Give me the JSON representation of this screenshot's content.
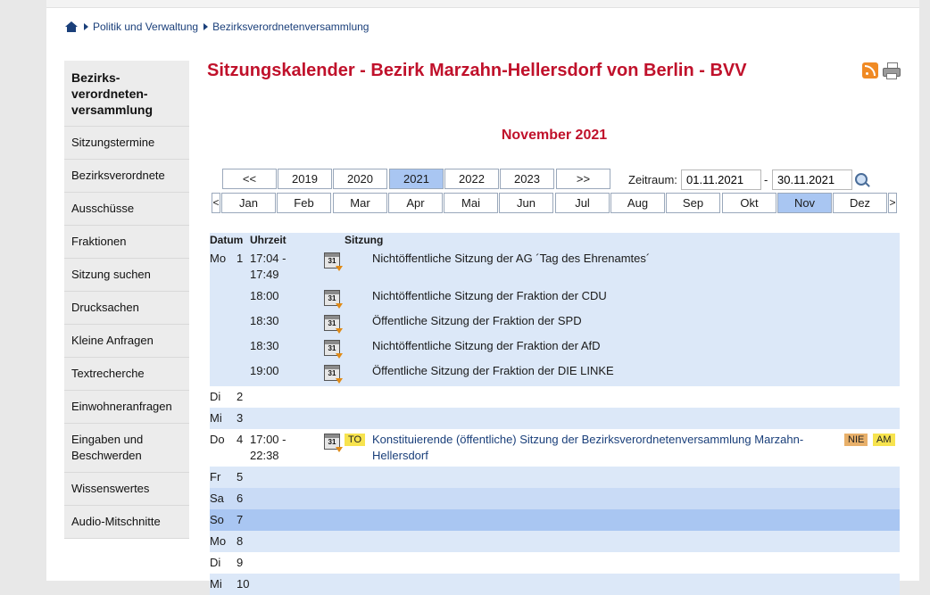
{
  "breadcrumb": {
    "items": [
      "Politik und Verwaltung",
      "Bezirksverordnetenversammlung"
    ]
  },
  "sidebar": {
    "heading": "Bezirks- verordneten- versammlung",
    "heading_lines": [
      "Bezirks-",
      "verordneten-",
      "versammlung"
    ],
    "items": [
      "Sitzungstermine",
      "Bezirksverordnete",
      "Ausschüsse",
      "Fraktionen",
      "Sitzung suchen",
      "Drucksachen",
      "Kleine Anfragen",
      "Textrecherche",
      "Einwohneranfragen",
      "Eingaben und Beschwerden",
      "Wissenswertes",
      "Audio-Mitschnitte"
    ]
  },
  "page": {
    "title": "Sitzungskalender - Bezirk Marzahn-Hellersdorf von Berlin - BVV",
    "month_heading": "November 2021"
  },
  "icons": [
    "rss-icon",
    "printer-icon",
    "search-icon",
    "calendar-icon",
    "home-icon"
  ],
  "year_nav": {
    "prev": "<<",
    "years": [
      "2019",
      "2020",
      "2021",
      "2022",
      "2023"
    ],
    "next": ">>",
    "selected": "2021"
  },
  "month_nav": {
    "prev": "<",
    "months": [
      "Jan",
      "Feb",
      "Mar",
      "Apr",
      "Mai",
      "Jun",
      "Jul",
      "Aug",
      "Sep",
      "Okt",
      "Nov",
      "Dez"
    ],
    "next": ">",
    "selected": "Nov"
  },
  "zeitraum": {
    "label": "Zeitraum:",
    "from": "01.11.2021",
    "to": "30.11.2021",
    "separator": "-"
  },
  "table": {
    "headers": {
      "datum": "Datum",
      "uhrzeit": "Uhrzeit",
      "sitzung": "Sitzung"
    },
    "day1": {
      "wd": "Mo",
      "num": "1"
    },
    "day1_sessions": [
      {
        "time1": "17:04 -",
        "time2": "17:49",
        "title": "Nichtöffentliche Sitzung der AG ´Tag des Ehrenamtes´"
      },
      {
        "time1": "18:00",
        "title": "Nichtöffentliche Sitzung der Fraktion der CDU"
      },
      {
        "time1": "18:30",
        "title": "Öffentliche Sitzung der Fraktion der SPD"
      },
      {
        "time1": "18:30",
        "title": "Nichtöffentliche Sitzung der Fraktion der AfD"
      },
      {
        "time1": "19:00",
        "title": "Öffentliche Sitzung der Fraktion der DIE LINKE"
      }
    ],
    "day2": {
      "wd": "Di",
      "num": "2"
    },
    "day3": {
      "wd": "Mi",
      "num": "3"
    },
    "day4": {
      "wd": "Do",
      "num": "4",
      "time1": "17:00 -",
      "time2": "22:38",
      "tag": "TO",
      "title_line1": "Konstituierende (öffentliche) Sitzung der Bezirksverordnetenversammlung Marzahn-",
      "title_line2": "Hellersdorf",
      "title": "Konstituierende (öffentliche) Sitzung der Bezirksverordnetenversammlung Marzahn-Hellersdorf",
      "badges": [
        "NIE",
        "AM"
      ]
    },
    "day5": {
      "wd": "Fr",
      "num": "5"
    },
    "day6": {
      "wd": "Sa",
      "num": "6"
    },
    "day7": {
      "wd": "So",
      "num": "7"
    },
    "day8": {
      "wd": "Mo",
      "num": "8"
    },
    "day9": {
      "wd": "Di",
      "num": "9"
    },
    "day10": {
      "wd": "Mi",
      "num": "10"
    }
  },
  "calendar_icon_text": "31",
  "colors": {
    "title_red": "#c0112b",
    "link_blue": "#1a3f7a",
    "selected_blue": "#a9c6f2",
    "row_light": "#dce8f8",
    "row_mid": "#c9dbf6",
    "tag_yellow": "#f7e34e",
    "tag_orange": "#e8b06a"
  }
}
